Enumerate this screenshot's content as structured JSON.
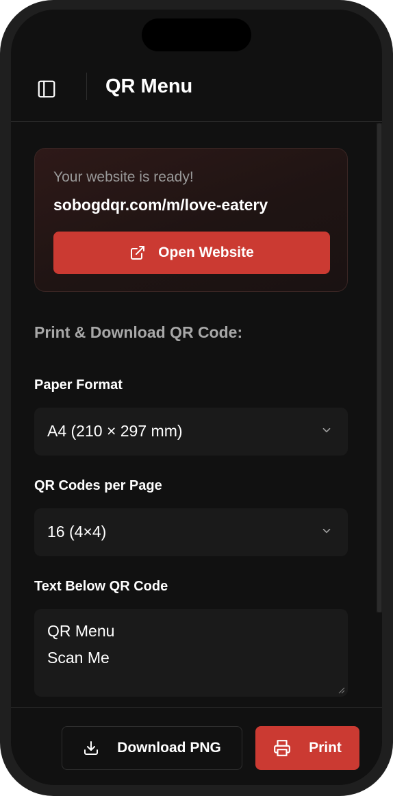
{
  "header": {
    "title": "QR Menu",
    "sidebar_toggle_icon": "sidebar-toggle-icon"
  },
  "ready_card": {
    "label": "Your website is ready!",
    "url": "sobogdqr.com/m/love-eatery",
    "open_button_label": "Open Website",
    "open_button_icon": "external-link-icon"
  },
  "print_section": {
    "title": "Print & Download QR Code:",
    "paper_format": {
      "label": "Paper Format",
      "value": "A4 (210 × 297 mm)"
    },
    "qr_per_page": {
      "label": "QR Codes per Page",
      "value": "16 (4×4)"
    },
    "text_below": {
      "label": "Text Below QR Code",
      "lines": [
        "QR Menu",
        "Scan Me"
      ]
    }
  },
  "footer": {
    "download_label": "Download PNG",
    "download_icon": "download-icon",
    "print_label": "Print",
    "print_icon": "printer-icon"
  },
  "colors": {
    "accent": "#cb3a32",
    "background": "#111111",
    "surface": "#1a1a1a",
    "muted_text": "#a8a8a8"
  }
}
